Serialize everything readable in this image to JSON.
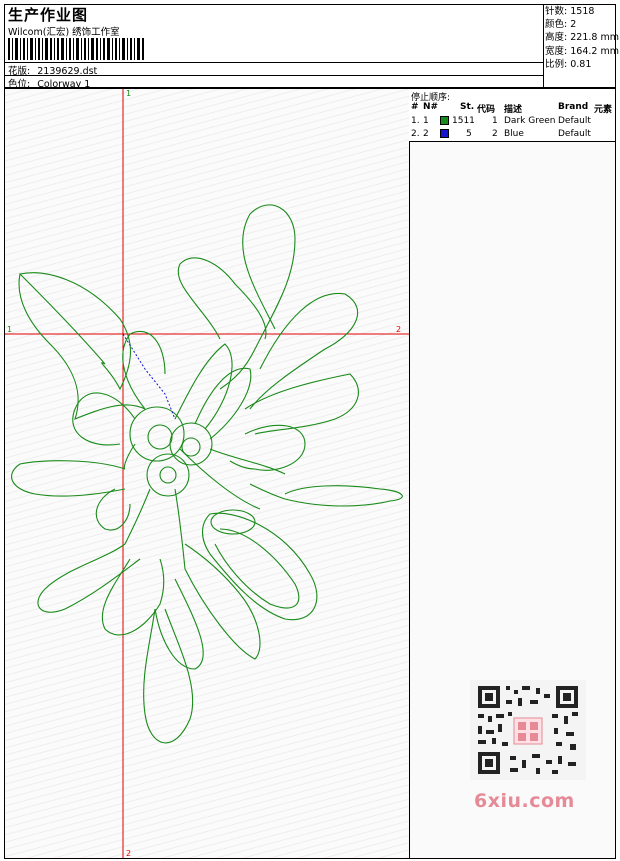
{
  "header": {
    "title": "生产作业图",
    "studio": "Wilcom(汇宏) 绣饰工作室",
    "pattern_label": "花版:",
    "pattern_value": "2139629.dst",
    "colorway_label": "色位:",
    "colorway_value": "Colorway 1"
  },
  "stats": {
    "stitches_label": "针数:",
    "stitches_value": "1518",
    "colors_label": "颜色:",
    "colors_value": "2",
    "height_label": "高度:",
    "height_value": "221.8 mm",
    "width_label": "宽度:",
    "width_value": "164.2 mm",
    "scale_label": "比例:",
    "scale_value": "0.81"
  },
  "stop_sequence": {
    "caption": "停止顺序:",
    "headers": [
      "#",
      "N#",
      "St.",
      "代码",
      "描述",
      "Brand",
      "元素"
    ],
    "rows": [
      {
        "index": "1.",
        "needle": "1",
        "color": "#1a8a1a",
        "stitches": "1511",
        "code": "1",
        "description": "Dark Green",
        "brand": "Default"
      },
      {
        "index": "2.",
        "needle": "2",
        "color": "#1515d0",
        "stitches": "5",
        "code": "2",
        "description": "Blue",
        "brand": "Default"
      }
    ]
  },
  "design": {
    "axis_labels": {
      "top": "1",
      "bottom": "2",
      "left": "1",
      "right": "2"
    },
    "thread_color": "#1a8a1a",
    "jump_color": "#1515d0",
    "axis_color": "#e00000"
  },
  "watermark": {
    "text": "6xiu.com",
    "color": "#e58a96"
  }
}
